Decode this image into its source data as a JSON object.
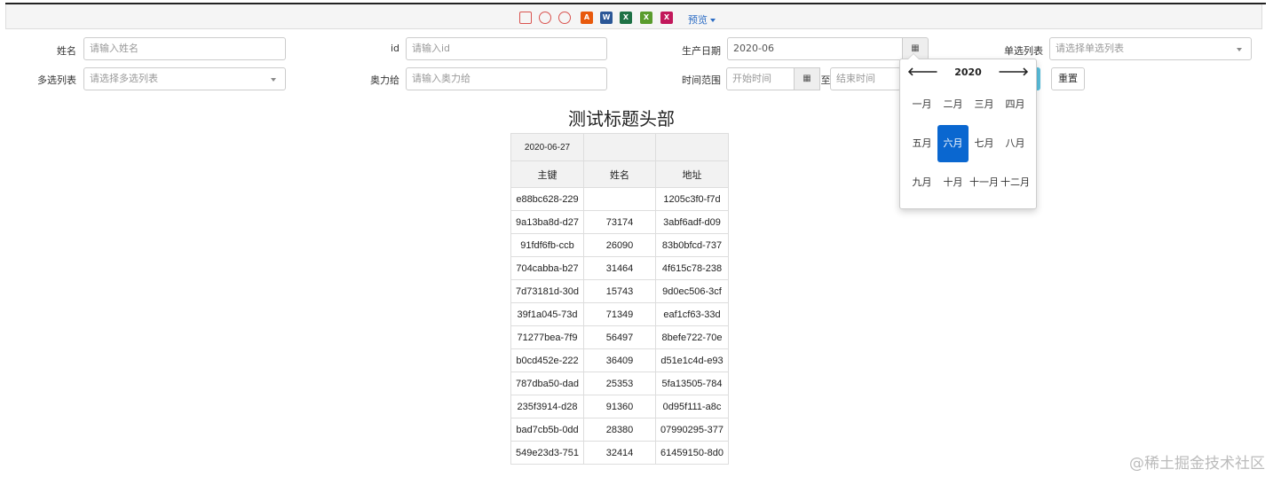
{
  "toolbar": {
    "icons": [
      {
        "name": "print-icon",
        "color": "#d9534f"
      },
      {
        "name": "print-preview-icon",
        "color": "#d9534f"
      },
      {
        "name": "print-setup-icon",
        "color": "#d9534f"
      },
      {
        "name": "pdf-icon",
        "color": "#e8590c"
      },
      {
        "name": "word-icon",
        "color": "#2b5797"
      },
      {
        "name": "excel-icon",
        "color": "#1e7145"
      },
      {
        "name": "excel-icon-2",
        "color": "#5a9c2d"
      },
      {
        "name": "excel-icon-3",
        "color": "#c2185b"
      }
    ],
    "preview_label": "预览"
  },
  "form": {
    "name_label": "姓名",
    "name_placeholder": "请输入姓名",
    "id_label": "id",
    "id_placeholder": "请输入id",
    "date_label": "生产日期",
    "date_value": "2020-06",
    "single_label": "单选列表",
    "single_placeholder": "请选择单选列表",
    "multi_label": "多选列表",
    "multi_placeholder": "请选择多选列表",
    "aoligei_label": "奥力给",
    "aoligei_placeholder": "请输入奥力给",
    "range_label": "时间范围",
    "range_start_placeholder": "开始时间",
    "range_to": "至",
    "range_end_placeholder": "结束时间",
    "reset_label": "重置"
  },
  "report": {
    "title": "测试标题头部",
    "date_cell": "2020-06-27",
    "headers": [
      "主键",
      "姓名",
      "地址"
    ],
    "rows": [
      [
        "e88bc628-229",
        "",
        "1205c3f0-f7d"
      ],
      [
        "9a13ba8d-d27",
        "73174",
        "3abf6adf-d09"
      ],
      [
        "91fdf6fb-ccb",
        "26090",
        "83b0bfcd-737"
      ],
      [
        "704cabba-b27",
        "31464",
        "4f615c78-238"
      ],
      [
        "7d73181d-30d",
        "15743",
        "9d0ec506-3cf"
      ],
      [
        "39f1a045-73d",
        "71349",
        "eaf1cf63-33d"
      ],
      [
        "71277bea-7f9",
        "56497",
        "8befe722-70e"
      ],
      [
        "b0cd452e-222",
        "36409",
        "d51e1c4d-e93"
      ],
      [
        "787dba50-dad",
        "25353",
        "5fa13505-784"
      ],
      [
        "235f3914-d28",
        "91360",
        "0d95f111-a8c"
      ],
      [
        "bad7cb5b-0dd",
        "28380",
        "07990295-377"
      ],
      [
        "549e23d3-751",
        "32414",
        "61459150-8d0"
      ]
    ]
  },
  "datepicker": {
    "year": "2020",
    "prev": "🡐",
    "next": "🡒",
    "months": [
      "一月",
      "二月",
      "三月",
      "四月",
      "五月",
      "六月",
      "七月",
      "八月",
      "九月",
      "十月",
      "十一月",
      "十二月"
    ],
    "selected": "六月"
  },
  "watermark": "@稀土掘金技术社区"
}
